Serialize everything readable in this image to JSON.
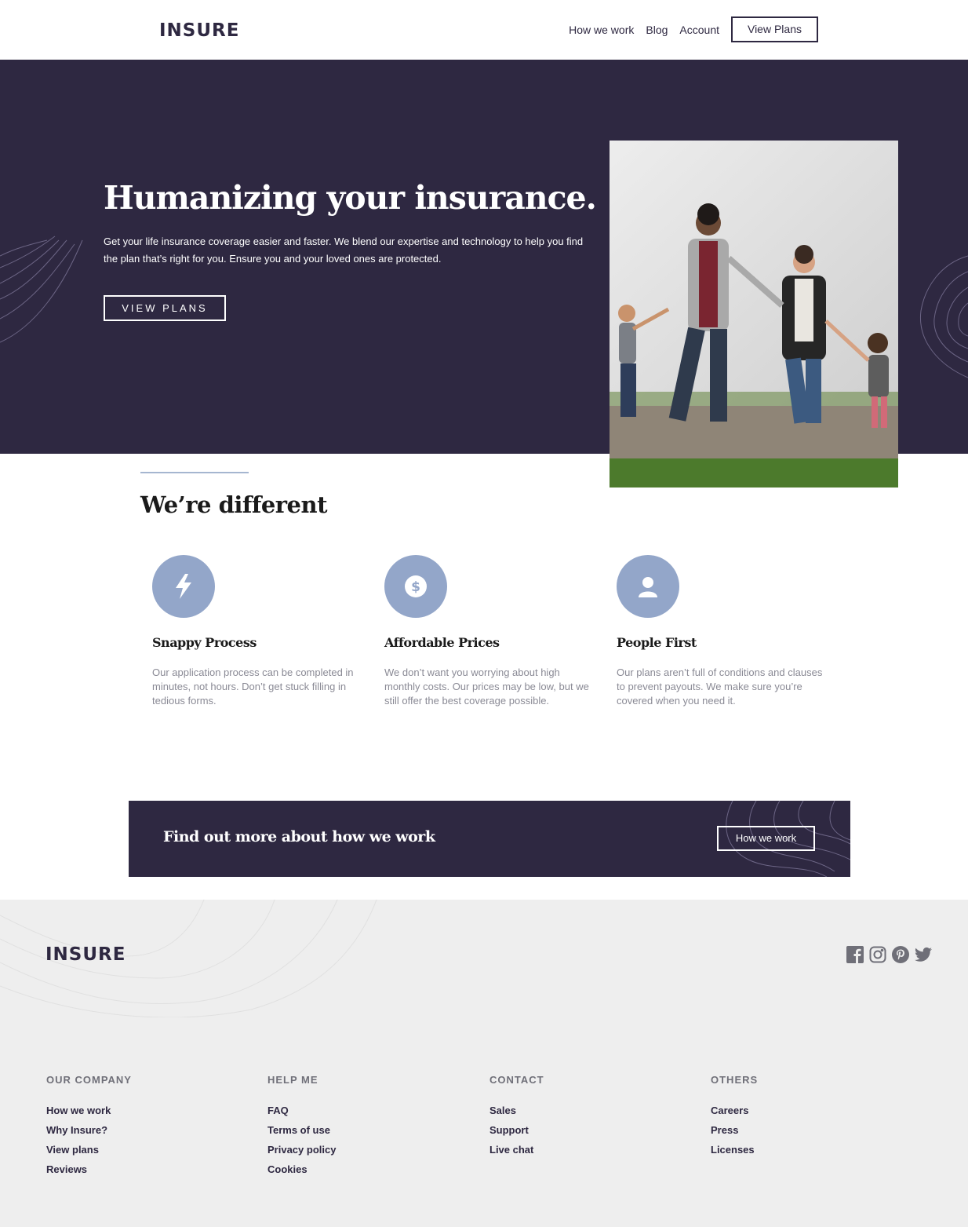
{
  "header": {
    "logo": "INSURE",
    "nav": [
      "How we work",
      "Blog",
      "Account"
    ],
    "cta": "View Plans"
  },
  "hero": {
    "title": "Humanizing your insurance.",
    "text": "Get your life insurance coverage easier and faster. We blend our expertise and technology to help you find the plan that’s right for you. Ensure you and your loved ones are protected.",
    "button": "VIEW PLANS"
  },
  "different": {
    "title": "We’re different",
    "features": [
      {
        "icon": "lightning-icon",
        "title": "Snappy Process",
        "text": "Our application process can be completed in minutes, not hours. Don’t get stuck filling in tedious forms."
      },
      {
        "icon": "dollar-icon",
        "title": "Affordable Prices",
        "text": "We don’t want you worrying about high monthly costs. Our prices may be low, but we still offer the best coverage possible."
      },
      {
        "icon": "person-icon",
        "title": "People First",
        "text": "Our plans aren’t full of conditions and clauses to prevent payouts. We make sure you’re covered when you need it."
      }
    ]
  },
  "cta": {
    "title": "Find out more about how we work",
    "button": "How we work"
  },
  "footer": {
    "logo": "INSURE",
    "social": [
      "facebook-icon",
      "instagram-icon",
      "pinterest-icon",
      "twitter-icon"
    ],
    "columns": [
      {
        "heading": "OUR COMPANY",
        "links": [
          "How we work",
          "Why Insure?",
          "View plans",
          "Reviews"
        ]
      },
      {
        "heading": "HELP ME",
        "links": [
          "FAQ",
          "Terms of use",
          "Privacy policy",
          "Cookies"
        ]
      },
      {
        "heading": "CONTACT",
        "links": [
          "Sales",
          "Support",
          "Live chat"
        ]
      },
      {
        "heading": "OTHERS",
        "links": [
          "Careers",
          "Press",
          "Licenses"
        ]
      }
    ]
  },
  "colors": {
    "dark_violet": "#2e2841",
    "accent_blue": "#93a6c9",
    "footer_bg": "#eeeeee"
  }
}
